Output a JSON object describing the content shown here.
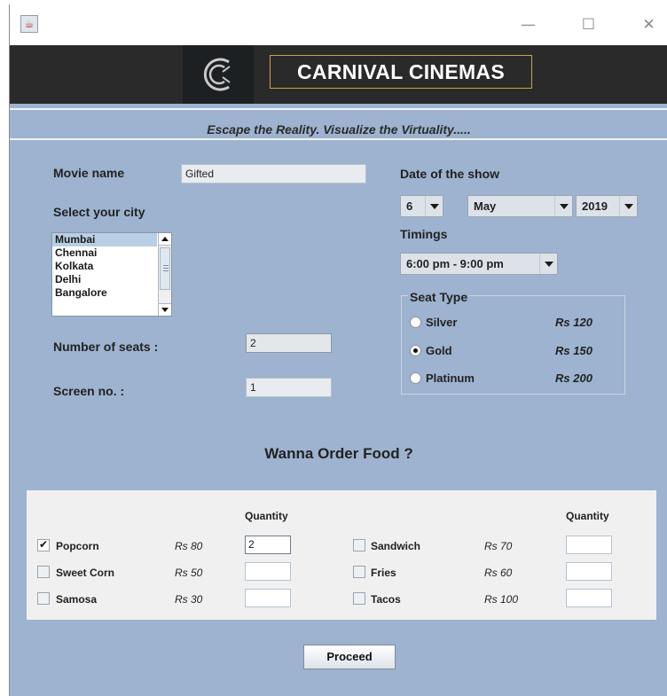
{
  "window": {
    "icon": "java-cup-icon",
    "controls": {
      "minimize": "—",
      "maximize": "☐",
      "close": "✕"
    }
  },
  "banner": {
    "brand": "CARNIVAL CINEMAS",
    "logo_icon": "carnival-c-logo"
  },
  "tagline": "Escape the Reality. Visualize the Virtuality.....",
  "form": {
    "movie_label": "Movie name",
    "movie_value": "Gifted",
    "city_label": "Select your city",
    "cities": [
      "Mumbai",
      "Chennai",
      "Kolkata",
      "Delhi",
      "Bangalore"
    ],
    "selected_city": "Mumbai",
    "seats_label": "Number of seats :",
    "seats_value": "2",
    "screen_label": "Screen no. :",
    "screen_value": "1",
    "date_label": "Date of the show",
    "day": "6",
    "month": "May",
    "year": "2019",
    "timings_label": "Timings",
    "timing": "6:00 pm - 9:00 pm"
  },
  "seat_type": {
    "title": "Seat Type",
    "options": [
      {
        "label": "Silver",
        "price": "Rs 120",
        "selected": false
      },
      {
        "label": "Gold",
        "price": "Rs 150",
        "selected": true
      },
      {
        "label": "Platinum",
        "price": "Rs 200",
        "selected": false
      }
    ]
  },
  "food": {
    "title": "Wanna Order Food ?",
    "quantity_header": "Quantity",
    "left": [
      {
        "label": "Popcorn",
        "price": "Rs 80",
        "checked": true,
        "qty": "2"
      },
      {
        "label": "Sweet Corn",
        "price": "Rs 50",
        "checked": false,
        "qty": ""
      },
      {
        "label": "Samosa",
        "price": "Rs 30",
        "checked": false,
        "qty": ""
      }
    ],
    "right": [
      {
        "label": "Sandwich",
        "price": "Rs 70",
        "checked": false,
        "qty": ""
      },
      {
        "label": "Fries",
        "price": "Rs 60",
        "checked": false,
        "qty": ""
      },
      {
        "label": "Tacos",
        "price": "Rs 100",
        "checked": false,
        "qty": ""
      }
    ]
  },
  "actions": {
    "proceed": "Proceed"
  },
  "colors": {
    "background": "#9db3cf",
    "banner": "#2a2a2a",
    "brand_border": "#c8a44a",
    "food_panel": "#f0f0f0"
  }
}
